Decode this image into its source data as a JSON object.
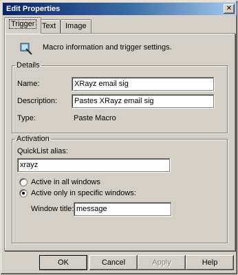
{
  "window": {
    "title": "Edit Properties",
    "close_glyph": "✕"
  },
  "tabs": [
    {
      "label": "Trigger",
      "active": true
    },
    {
      "label": "Text",
      "active": false
    },
    {
      "label": "Image",
      "active": false
    }
  ],
  "trigger": {
    "header_icon": "macro-trigger-icon",
    "info": "Macro information and trigger settings.",
    "details": {
      "legend": "Details",
      "name_label": "Name:",
      "name_value": "XRayz email sig",
      "description_label": "Description:",
      "description_value": "Pastes XRayz email sig",
      "type_label": "Type:",
      "type_value": "Paste Macro"
    },
    "activation": {
      "legend": "Activation",
      "quicklist_label": "QuickList alias:",
      "quicklist_value": "xrayz",
      "radio_all_label": "Active in all windows",
      "radio_specific_label": "Active only in specific windows:",
      "selected": "specific",
      "window_title_label": "Window title:",
      "window_title_value": "message"
    }
  },
  "buttons": {
    "ok": "OK",
    "cancel": "Cancel",
    "apply": "Apply",
    "help": "Help"
  }
}
